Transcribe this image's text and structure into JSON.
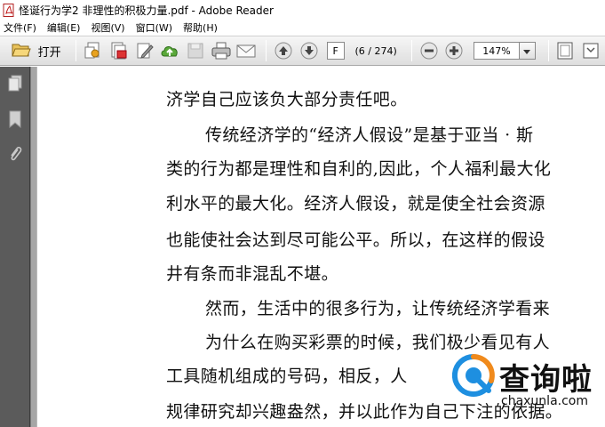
{
  "window": {
    "title": "怪诞行为学2 非理性的积极力量.pdf - Adobe Reader"
  },
  "menu": {
    "items": [
      "文件(F)",
      "编辑(E)",
      "视图(V)",
      "窗口(W)",
      "帮助(H)"
    ]
  },
  "toolbar": {
    "open_label": "打开",
    "page_value": "F",
    "page_count": "(6 / 274)",
    "zoom_value": "147%"
  },
  "icons": {
    "open": "folder-open-icon",
    "create_pdf": "create-pdf-icon",
    "combine": "combine-files-icon",
    "edit": "edit-document-icon",
    "upload": "cloud-upload-icon",
    "save": "save-icon",
    "print": "print-icon",
    "email": "email-icon",
    "prev_page": "arrow-up-icon",
    "next_page": "arrow-down-icon",
    "zoom_out": "minus-icon",
    "zoom_in": "plus-icon",
    "fit_page": "fit-page-icon",
    "read_mode": "read-mode-icon",
    "pages_panel": "pages-icon",
    "bookmarks_panel": "bookmark-icon",
    "attachments_panel": "paperclip-icon"
  },
  "document": {
    "lines": [
      "济学自己应该负大部分责任吧。",
      "传统经济学的“经济人假设”是基于亚当 · 斯",
      "类的行为都是理性和自利的,因此，个人福利最大化",
      "利水平的最大化。经济人假设，就是使全社会资源",
      "也能使社会达到尽可能公平。所以，在这样的假设",
      "井有条而非混乱不堪。",
      "然而，生活中的很多行为，让传统经济学看来",
      "为什么在购买彩票的时候，我们极少看见有人",
      "工具随机组成的号码，相反，人",
      "规律研究却兴趣盎然，并以此作为自己下注的依据。"
    ]
  },
  "watermark": {
    "name": "查询啦",
    "url": "chaxunla.com"
  },
  "colors": {
    "side_panel": "#5b5b5b",
    "toolbar_top": "#f6f6f6",
    "toolbar_bottom": "#dedede",
    "watermark_blue": "#1e8fe0",
    "watermark_orange": "#f08a1c"
  }
}
